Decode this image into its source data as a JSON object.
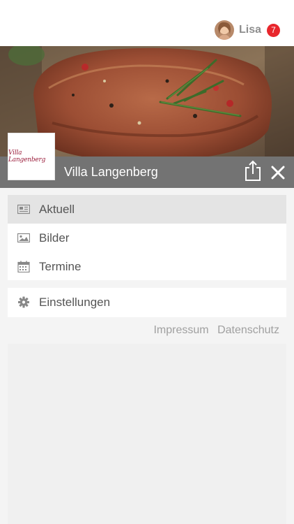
{
  "header": {
    "user_name": "Lisa",
    "notification_count": "7"
  },
  "venue": {
    "name": "Villa Langenberg",
    "logo_text": "Villa Langenberg"
  },
  "menu": {
    "items": [
      {
        "label": "Aktuell",
        "icon": "newspaper-icon",
        "active": true
      },
      {
        "label": "Bilder",
        "icon": "image-icon",
        "active": false
      },
      {
        "label": "Termine",
        "icon": "calendar-icon",
        "active": false
      }
    ],
    "settings": {
      "label": "Einstellungen",
      "icon": "gear-icon"
    }
  },
  "footer": {
    "impressum": "Impressum",
    "datenschutz": "Datenschutz"
  },
  "colors": {
    "badge": "#e8262c",
    "titlebar": "#737373",
    "active_item": "#e4e4e4",
    "logo_text": "#9a1c3a"
  }
}
